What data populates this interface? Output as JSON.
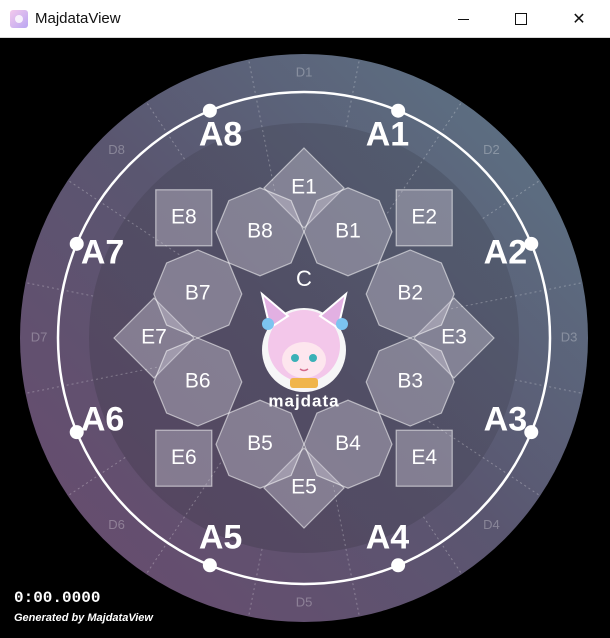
{
  "window": {
    "title": "MajdataView",
    "icon": "majdata-app-icon",
    "controls": {
      "minimize": "minimize-icon",
      "maximize": "maximize-icon",
      "close": "✕"
    }
  },
  "colors": {
    "ring_outer": "#5a6678",
    "ring_inner": "#4a4058",
    "sensor_fill": "rgba(200,195,210,0.42)",
    "button_marker": "#ffffff"
  },
  "outer_buttons": [
    "A1",
    "A2",
    "A3",
    "A4",
    "A5",
    "A6",
    "A7",
    "A8"
  ],
  "d_zones": [
    "D1",
    "D2",
    "D3",
    "D4",
    "D5",
    "D6",
    "D7",
    "D8"
  ],
  "b_zones": [
    "B1",
    "B2",
    "B3",
    "B4",
    "B5",
    "B6",
    "B7",
    "B8"
  ],
  "e_zones": [
    "E1",
    "E2",
    "E3",
    "E4",
    "E5",
    "E6",
    "E7",
    "E8"
  ],
  "center": {
    "label": "C",
    "logo": "majdata"
  },
  "footer": {
    "time": "0:00.0000",
    "credit": "Generated by MajdataView"
  }
}
